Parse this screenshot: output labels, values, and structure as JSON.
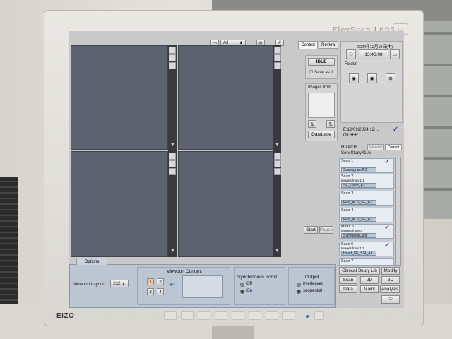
{
  "monitor": {
    "brand_model": "FlexScan L695",
    "manufacturer": "EIZO"
  },
  "viewer": {
    "top_toolbar": {
      "selector_value": "All"
    },
    "tabs": [
      {
        "label": "Control"
      },
      {
        "label": "Review"
      }
    ],
    "status": {
      "datetime": "2024年12月19日(木)",
      "time": "13:46:08",
      "folder_label": "Folder:"
    },
    "controls": {
      "idle_label": "IDLE",
      "save_as_label": "Save as",
      "save_as_value": "1",
      "images_from_label": "Images from",
      "database_label": "Database",
      "start_label": "Start",
      "pause_label": "Pause"
    },
    "patient": {
      "line1": "E:12/09/2024 12:...",
      "line2": "OTHER",
      "check": "✓"
    },
    "study": {
      "vendor": "HITACHI",
      "study": "Serv.Study#1;Ai",
      "worklist_label": "Worklist",
      "correct_label": "Correct"
    },
    "scans": [
      {
        "title": "Scan 1",
        "subtitle": "",
        "param": "Scanogram PS",
        "checked": true
      },
      {
        "title": "Scan 2",
        "subtitle": "Images from 1,1",
        "param": "SE_GeIm_AX",
        "checked": false
      },
      {
        "title": "Scan 3",
        "subtitle": "",
        "param": "FEN_ADJ_SE_AX",
        "checked": false
      },
      {
        "title": "Scan 4",
        "subtitle": "",
        "param": "FEN_ADJ_SE_AX",
        "checked": false
      },
      {
        "title": "Maint 5",
        "subtitle": "Images from 0",
        "param": "SymMeIntCard",
        "checked": true
      },
      {
        "title": "Scan 6",
        "subtitle": "Images from 1,1",
        "param": "Head_SE_S/R_AX",
        "checked": true
      },
      {
        "title": "Scan 7",
        "subtitle": "",
        "param": "",
        "checked": false
      }
    ],
    "bottom_buttons": [
      {
        "label": "Clinical Study Lib"
      },
      {
        "label": "Modify"
      },
      {
        "label": "Scan"
      },
      {
        "label": "2D"
      },
      {
        "label": "3D"
      },
      {
        "label": "Data"
      },
      {
        "label": "Maint"
      },
      {
        "label": "Analysis"
      }
    ],
    "options": {
      "tab_label": "Options",
      "viewport_layout_label": "Viewport Layout:",
      "viewport_layout_value": "2x2",
      "viewport_content_label": "Viewport Content",
      "viewport_numbers": [
        "1",
        "2",
        "3",
        "4"
      ],
      "sync_scroll_label": "Synchronous Scroll",
      "sync_off": "Off",
      "sync_on": "On",
      "sync_selected": "On",
      "output_label": "Output",
      "output_interleaved": "interleaved",
      "output_sequential": "sequential",
      "output_selected": "sequential"
    }
  }
}
